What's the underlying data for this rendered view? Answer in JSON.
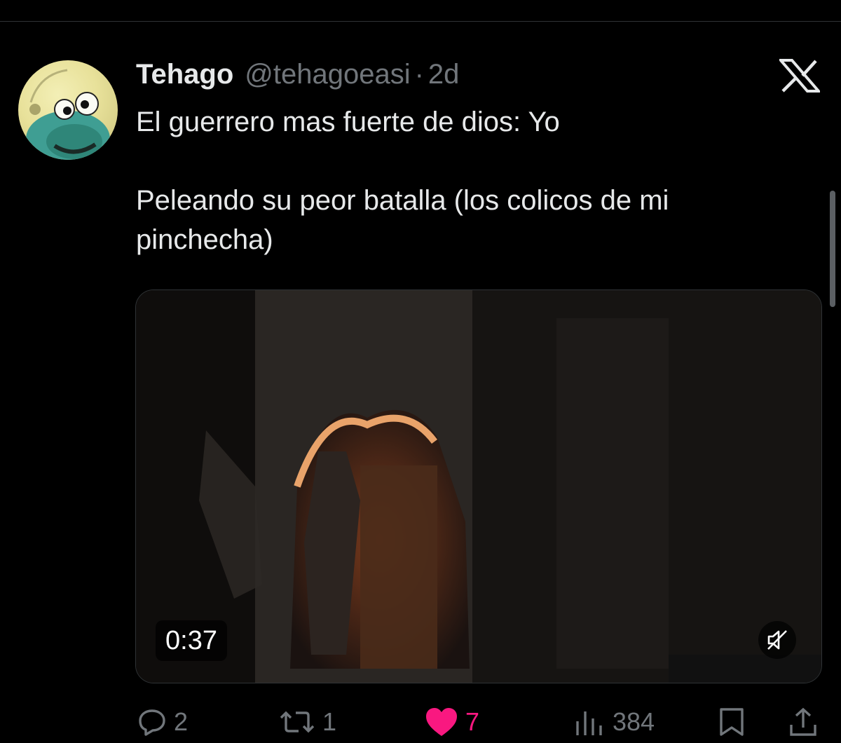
{
  "tweet": {
    "display_name": "Tehago",
    "handle": "@tehagoeasi",
    "separator": "·",
    "time": "2d",
    "text_lines": [
      "El guerrero mas fuerte de dios: Yo",
      "Peleando su peor batalla (los colicos de mi pinchecha)"
    ]
  },
  "media": {
    "duration": "0:37",
    "muted_icon": "speaker-muted-icon"
  },
  "actions": {
    "replies": "2",
    "reposts": "1",
    "likes": "7",
    "views": "384"
  },
  "icons": {
    "logo": "x-logo-icon",
    "reply": "reply-icon",
    "repost": "repost-icon",
    "like": "heart-icon",
    "views": "views-icon",
    "bookmark": "bookmark-icon",
    "share": "share-icon"
  },
  "colors": {
    "background": "#000000",
    "text": "#e7e9ea",
    "muted_text": "#71767b",
    "like_accent": "#f91880",
    "divider": "#2f3336"
  }
}
